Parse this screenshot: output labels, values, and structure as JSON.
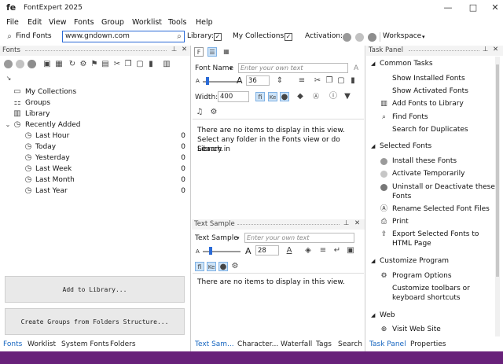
{
  "window": {
    "title": "FontExpert 2025",
    "logo": "fe",
    "minimize": "—",
    "maximize": "□",
    "close": "✕"
  },
  "menu": [
    "File",
    "Edit",
    "View",
    "Fonts",
    "Group",
    "Worklist",
    "Tools",
    "Help"
  ],
  "toolbar": {
    "find_fonts": "Find Fonts",
    "url_value": "www.gndown.com",
    "library_label": "Library:",
    "collections_label": "My Collections:",
    "activation_label": "Activation:",
    "workspace_label": "Workspace",
    "check": "✓"
  },
  "fonts_panel": {
    "title": "Fonts",
    "pin": "📌",
    "close": "✕",
    "tree": [
      {
        "label": "My Collections",
        "icon": "collections-icon"
      },
      {
        "label": "Groups",
        "icon": "groups-icon"
      },
      {
        "label": "Library",
        "icon": "library-icon"
      },
      {
        "label": "Recently Added",
        "icon": "clock-icon"
      }
    ],
    "recent": [
      {
        "label": "Last Hour",
        "count": "0"
      },
      {
        "label": "Today",
        "count": "0"
      },
      {
        "label": "Yesterday",
        "count": "0"
      },
      {
        "label": "Last Week",
        "count": "0"
      },
      {
        "label": "Last Month",
        "count": "0"
      },
      {
        "label": "Last Year",
        "count": "0"
      }
    ],
    "add_library": "Add to Library...",
    "create_groups": "Create Groups from Folders Structure...",
    "tabs": [
      "Fonts",
      "Worklist",
      "System Fonts",
      "Folders"
    ]
  },
  "center": {
    "font_name_label": "Font Name",
    "own_text_placeholder": "Enter your own text",
    "size_value": "36",
    "width_label": "Width:",
    "width_value": "400",
    "empty_msg_1": "There are no items to display in this view.",
    "empty_msg_2": "Select any folder in the Fonts view or do Search in",
    "empty_msg_3": "Library.",
    "text_sample_title": "Text Sample",
    "text_sample_label": "Text Sample",
    "sample_size": "28",
    "sample_empty": "There are no items to display in this view.",
    "tabs": [
      "Text Sam...",
      "Character...",
      "Waterfall",
      "Tags",
      "Search"
    ]
  },
  "task_panel": {
    "title": "Task Panel",
    "sections": {
      "common": "Common Tasks",
      "selected": "Selected Fonts",
      "customize": "Customize Program",
      "web": "Web"
    },
    "common_items": [
      "Show Installed Fonts",
      "Show Activated Fonts",
      "Add Fonts to Library",
      "Find Fonts",
      "Search for Duplicates"
    ],
    "selected_items": [
      "Install these Fonts",
      "Activate Temporarily",
      "Uninstall or Deactivate these",
      "Fonts",
      "Rename Selected Font Files",
      "Print",
      "Export Selected Fonts to",
      "HTML Page"
    ],
    "customize_items": [
      "Program Options",
      "Customize toolbars or",
      "keyboard shortcuts"
    ],
    "web_items": [
      "Visit Web Site"
    ],
    "tabs": [
      "Task Panel",
      "Properties"
    ]
  },
  "colors": {
    "accent": "#2a6ad6",
    "status": "#68217a"
  }
}
